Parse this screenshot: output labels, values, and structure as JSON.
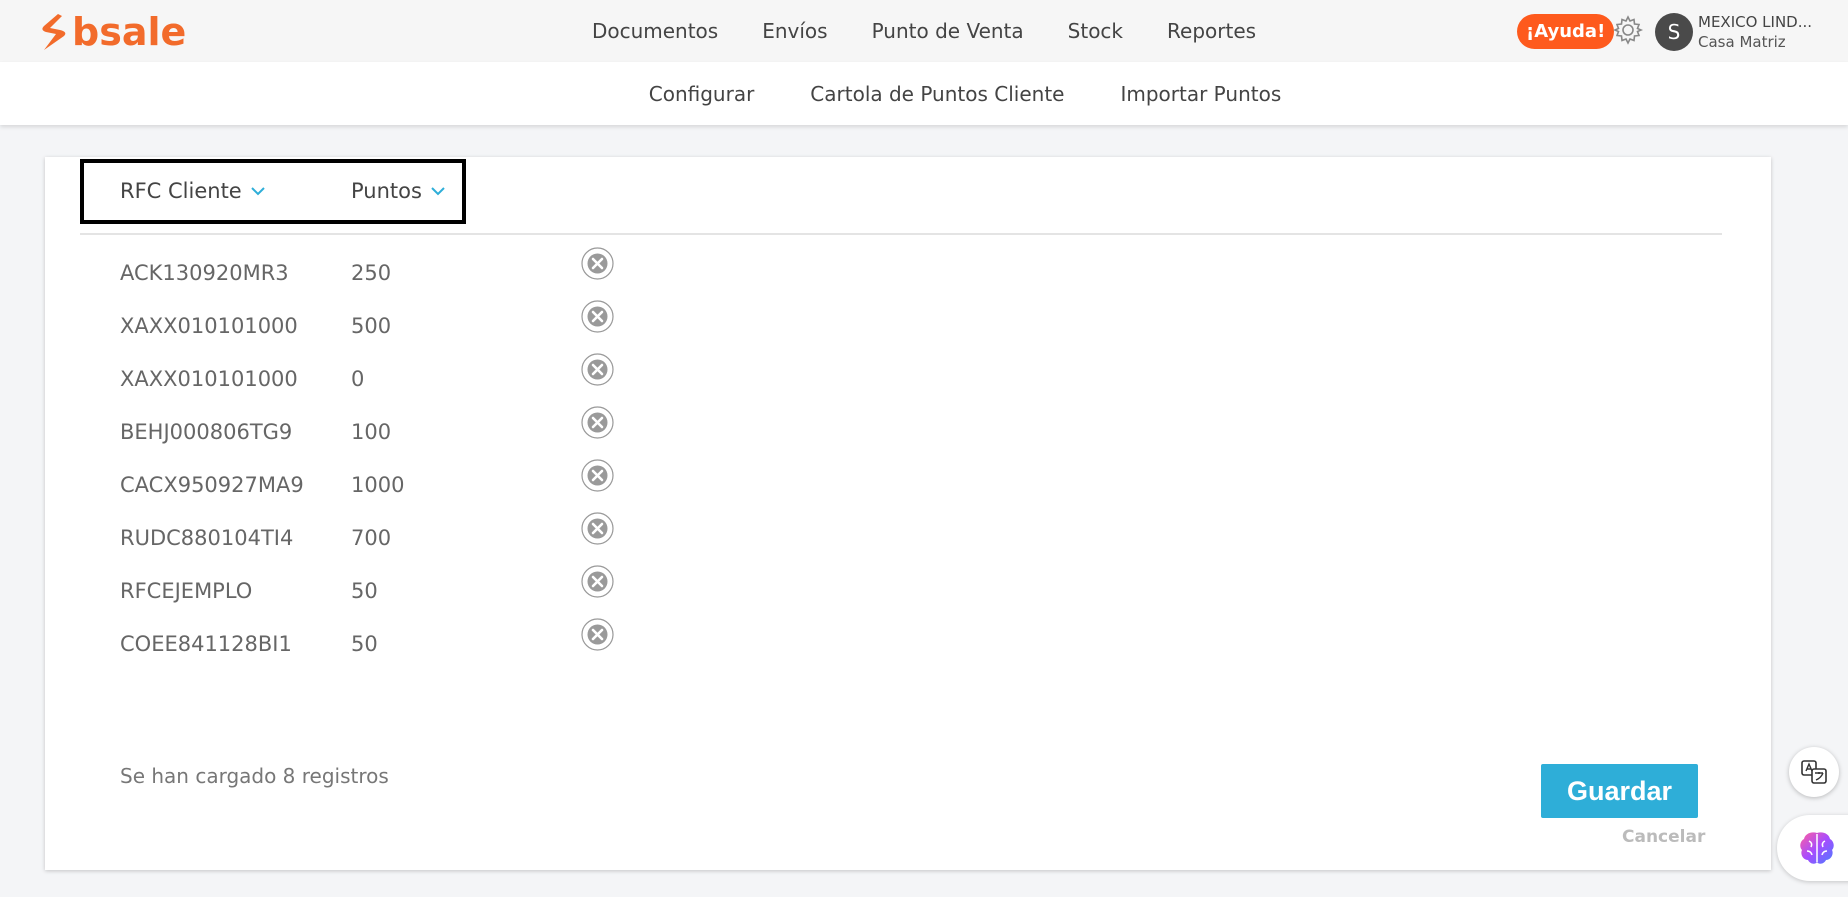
{
  "brand": {
    "name": "bsale",
    "color": "#f26b2b"
  },
  "nav": {
    "items": [
      "Documentos",
      "Envíos",
      "Punto de Venta",
      "Stock",
      "Reportes"
    ]
  },
  "header": {
    "help_label": "¡Ayuda!",
    "avatar_initial": "S",
    "account_name": "MEXICO LIND...",
    "account_branch": "Casa Matriz"
  },
  "subnav": {
    "items": [
      "Configurar",
      "Cartola de Puntos Cliente",
      "Importar Puntos"
    ]
  },
  "table": {
    "columns": [
      "RFC Cliente",
      "Puntos"
    ],
    "rows": [
      {
        "rfc": "ACK130920MR3",
        "points": "250"
      },
      {
        "rfc": "XAXX010101000",
        "points": "500"
      },
      {
        "rfc": "XAXX010101000",
        "points": "0"
      },
      {
        "rfc": "BEHJ000806TG9",
        "points": "100"
      },
      {
        "rfc": "CACX950927MA9",
        "points": "1000"
      },
      {
        "rfc": "RUDC880104TI4",
        "points": "700"
      },
      {
        "rfc": "RFCEJEMPLO",
        "points": "50"
      },
      {
        "rfc": "COEE841128BI1",
        "points": "50"
      }
    ]
  },
  "footer": {
    "status": "Se han cargado 8 registros",
    "save_label": "Guardar",
    "cancel_label": "Cancelar"
  },
  "colors": {
    "accent": "#2eaed8",
    "help": "#fe5a1d",
    "nav_underline": "#f6c9a3"
  }
}
